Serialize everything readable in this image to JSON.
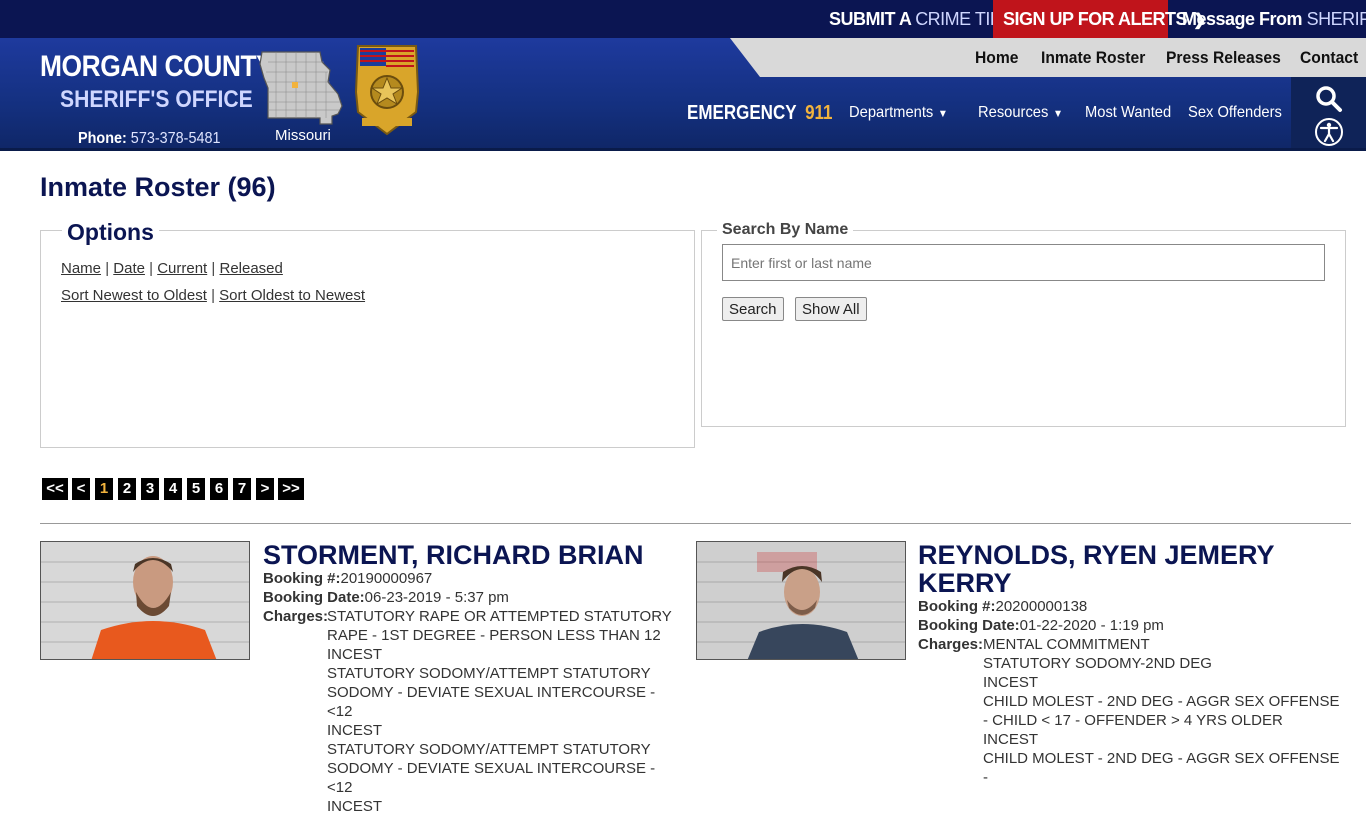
{
  "topbar": {
    "crime_tip_bold": "SUBMIT A",
    "crime_tip_light": "CRIME TIP",
    "alerts": "SIGN UP FOR ALERTS",
    "sheriff_msg_bold": "Message From",
    "sheriff_msg_light": "SHERIFF"
  },
  "brand": {
    "line1": "MORGAN COUNTY",
    "line2": "SHERIFF'S OFFICE",
    "phone_label": "Phone:",
    "phone": "573-378-5481",
    "state": "Missouri"
  },
  "nav": {
    "top": [
      "Home",
      "Inmate Roster",
      "Press Releases",
      "Contact"
    ],
    "emergency_label": "EMERGENCY",
    "emergency_number": "911",
    "sub": [
      "Departments",
      "Resources",
      "Most Wanted",
      "Sex Offenders"
    ]
  },
  "page": {
    "title": "Inmate Roster (96)"
  },
  "options": {
    "legend": "Options",
    "sort_links": [
      "Name",
      "Date",
      "Current",
      "Released"
    ],
    "order_links": [
      "Sort Newest to Oldest",
      "Sort Oldest to Newest"
    ],
    "sep": "|"
  },
  "search": {
    "legend": "Search By Name",
    "placeholder": "Enter first or last name",
    "search_label": "Search",
    "show_all_label": "Show All"
  },
  "pager": {
    "first": "<<",
    "prev": "<",
    "pages": [
      "1",
      "2",
      "3",
      "4",
      "5",
      "6",
      "7"
    ],
    "current": "1",
    "next": ">",
    "last": ">>"
  },
  "labels": {
    "booking_no": "Booking #:",
    "booking_date": "Booking Date:",
    "charges": "Charges:"
  },
  "inmates": [
    {
      "name": "STORMENT, RICHARD BRIAN",
      "booking_no": "20190000967",
      "booking_date": "06-23-2019 - 5:37 pm",
      "charges": [
        "STATUTORY RAPE OR ATTEMPTED STATUTORY RAPE - 1ST DEGREE - PERSON LESS THAN 12",
        "INCEST",
        "STATUTORY SODOMY/ATTEMPT STATUTORY SODOMY - DEVIATE SEXUAL INTERCOURSE - <12",
        "INCEST",
        "STATUTORY SODOMY/ATTEMPT STATUTORY SODOMY - DEVIATE SEXUAL INTERCOURSE - <12",
        "INCEST"
      ]
    },
    {
      "name": "REYNOLDS, RYEN JEMERY KERRY",
      "booking_no": "20200000138",
      "booking_date": "01-22-2020 - 1:19 pm",
      "charges": [
        "MENTAL COMMITMENT",
        "STATUTORY SODOMY-2ND DEG",
        "INCEST",
        "CHILD MOLEST - 2ND DEG - AGGR SEX OFFENSE - CHILD < 17 - OFFENDER > 4 YRS OLDER",
        "INCEST",
        "CHILD MOLEST - 2ND DEG - AGGR SEX OFFENSE -"
      ]
    }
  ],
  "colors": {
    "navy": "#0b1552",
    "alert_red": "#c0141b",
    "accent_gold": "#f2b33d"
  }
}
